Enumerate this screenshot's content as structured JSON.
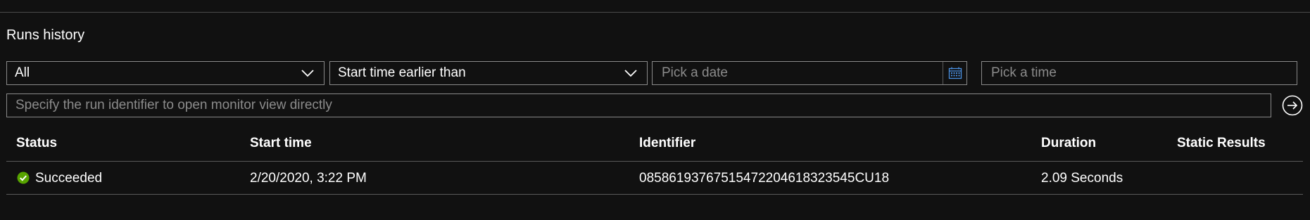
{
  "section": {
    "title": "Runs history"
  },
  "filters": {
    "status_value": "All",
    "time_filter_value": "Start time earlier than",
    "date_placeholder": "Pick a date",
    "time_placeholder": "Pick a time",
    "run_id_placeholder": "Specify the run identifier to open monitor view directly"
  },
  "table": {
    "columns": [
      "Status",
      "Start time",
      "Identifier",
      "Duration",
      "Static Results"
    ],
    "rows": [
      {
        "status": "Succeeded",
        "start_time": "2/20/2020, 3:22 PM",
        "identifier": "08586193767515472204618323545CU18",
        "duration": "2.09 Seconds",
        "static_results": ""
      }
    ]
  },
  "colors": {
    "success": "#57a300",
    "calendar_icon": "#4a90e2"
  }
}
